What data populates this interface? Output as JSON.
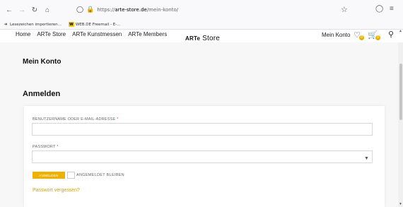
{
  "browser": {
    "url_prefix": "https://",
    "url_host": "arte-store.de",
    "url_path": "/mein-konto/",
    "icons": {
      "back": "back-arrow-icon",
      "forward": "forward-arrow-icon",
      "reload": "reload-icon",
      "home": "home-icon",
      "shield": "tracking-shield-icon",
      "lock": "lock-icon",
      "bookmark_star": "star-icon",
      "pocket": "pocket-icon",
      "menu": "hamburger-menu-icon"
    },
    "bookmarks": [
      {
        "label": "Lesezeichen importieren...",
        "icon": "import-icon"
      },
      {
        "label": "WEB.DE Freemail - E-...",
        "icon": "webde-icon"
      }
    ]
  },
  "site": {
    "nav": [
      "Home",
      "ARTe Store",
      "ARTe Kunstmessen",
      "ARTe Members"
    ],
    "logo": {
      "mark": "ARTe",
      "text": "Store"
    },
    "account_link": "Mein Konto",
    "wishlist_count": "0",
    "cart_count": "0"
  },
  "page": {
    "title": "Mein Konto",
    "section_title": "Anmelden",
    "username_label": "BENUTZERNAME ODER E-MAIL-ADRESSE",
    "password_label": "PASSWORT",
    "required_mark": "*",
    "username_value": "",
    "password_value": "",
    "login_button": "ANMELDEN",
    "remember_label": "ANGEMELDET BLEIBEN",
    "forgot_link": "Passwort vergessen?"
  },
  "colors": {
    "accent": "#efb100",
    "link": "#d6a300",
    "required": "#ee3333",
    "page_bg": "#f7f7f7"
  }
}
